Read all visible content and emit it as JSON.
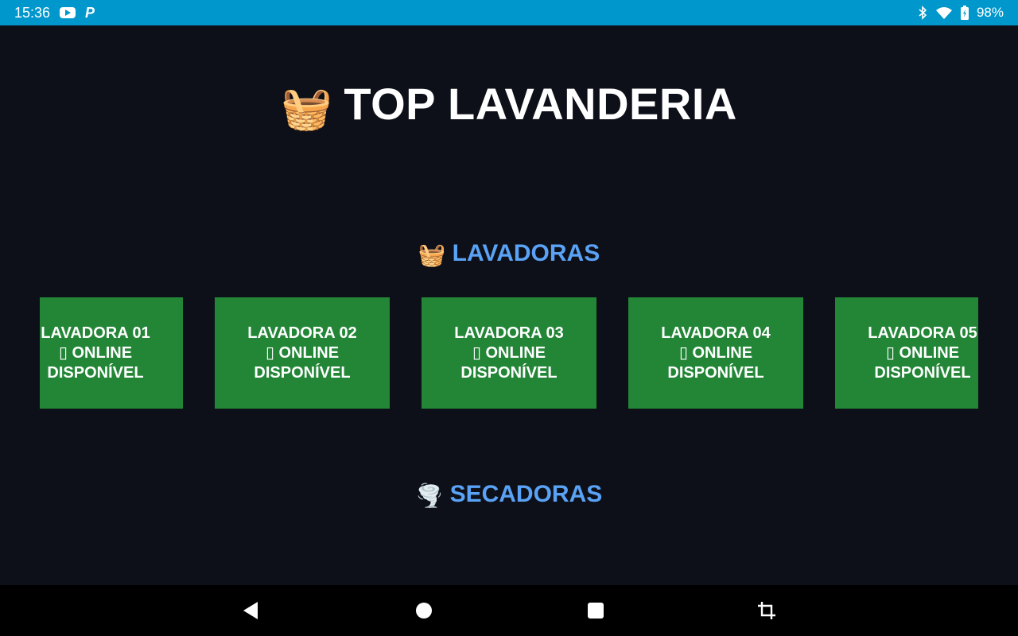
{
  "status_bar": {
    "time": "15:36",
    "battery": "98%",
    "icons": [
      "youtube-icon",
      "p-app-icon",
      "bluetooth-icon",
      "wifi-icon",
      "battery-icon"
    ]
  },
  "header": {
    "emoji": "🧺",
    "title": "TOP LAVANDERIA"
  },
  "sections": {
    "lavadoras": {
      "emoji": "🧺",
      "title": "LAVADORAS"
    },
    "secadoras": {
      "emoji": "🌪️",
      "title": "SECADORAS"
    }
  },
  "lavadoras": [
    {
      "name": "LAVADORA 01",
      "status": "▯ ONLINE",
      "availability": "DISPONÍVEL"
    },
    {
      "name": "LAVADORA 02",
      "status": "▯ ONLINE",
      "availability": "DISPONÍVEL"
    },
    {
      "name": "LAVADORA 03",
      "status": "▯ ONLINE",
      "availability": "DISPONÍVEL"
    },
    {
      "name": "LAVADORA 04",
      "status": "▯ ONLINE",
      "availability": "DISPONÍVEL"
    },
    {
      "name": "LAVADORA 05",
      "status": "▯ ONLINE",
      "availability": "DISPONÍVEL"
    }
  ],
  "colors": {
    "background": "#0d1018",
    "status_bar": "#0097cc",
    "card": "#228636",
    "section_title": "#5aa2f5"
  },
  "nav_bar": {
    "icons": [
      "back-icon",
      "home-icon",
      "recents-icon",
      "rotate-icon"
    ]
  }
}
